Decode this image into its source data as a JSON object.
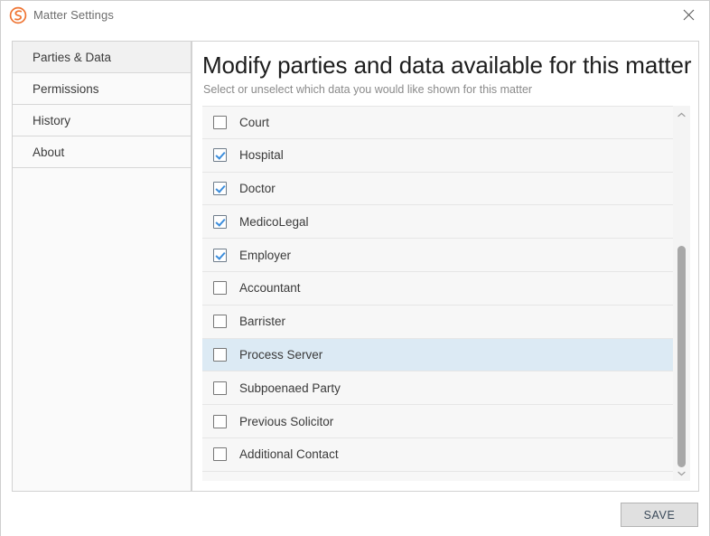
{
  "window": {
    "title": "Matter Settings",
    "logo_icon": "orange-swirl-logo",
    "close_icon": "close-icon"
  },
  "colors": {
    "accent_orange": "#ef7432",
    "checkbox_check": "#3b8ddc",
    "row_hover": "#dceaf4",
    "panel_border": "#d2d2d2",
    "list_background": "#f7f7f7",
    "save_button_face": "#e0e0e0"
  },
  "sidebar": {
    "items": [
      {
        "label": "Parties & Data",
        "selected": true
      },
      {
        "label": "Permissions",
        "selected": false
      },
      {
        "label": "History",
        "selected": false
      },
      {
        "label": "About",
        "selected": false
      }
    ]
  },
  "main": {
    "title": "Modify parties and data available for this matter",
    "subtitle": "Select or unselect which data you would like shown for this matter",
    "list": [
      {
        "label": "Court",
        "checked": false,
        "hovered": false
      },
      {
        "label": "Hospital",
        "checked": true,
        "hovered": false
      },
      {
        "label": "Doctor",
        "checked": true,
        "hovered": false
      },
      {
        "label": "MedicoLegal",
        "checked": true,
        "hovered": false
      },
      {
        "label": "Employer",
        "checked": true,
        "hovered": false
      },
      {
        "label": "Accountant",
        "checked": false,
        "hovered": false
      },
      {
        "label": "Barrister",
        "checked": false,
        "hovered": false
      },
      {
        "label": "Process Server",
        "checked": false,
        "hovered": true
      },
      {
        "label": "Subpoenaed Party",
        "checked": false,
        "hovered": false
      },
      {
        "label": "Previous Solicitor",
        "checked": false,
        "hovered": false
      },
      {
        "label": "Additional Contact",
        "checked": false,
        "hovered": false
      }
    ],
    "scrollbar": {
      "up_icon": "chevron-up-icon",
      "down_icon": "chevron-down-icon"
    }
  },
  "footer": {
    "save_label": "SAVE"
  }
}
